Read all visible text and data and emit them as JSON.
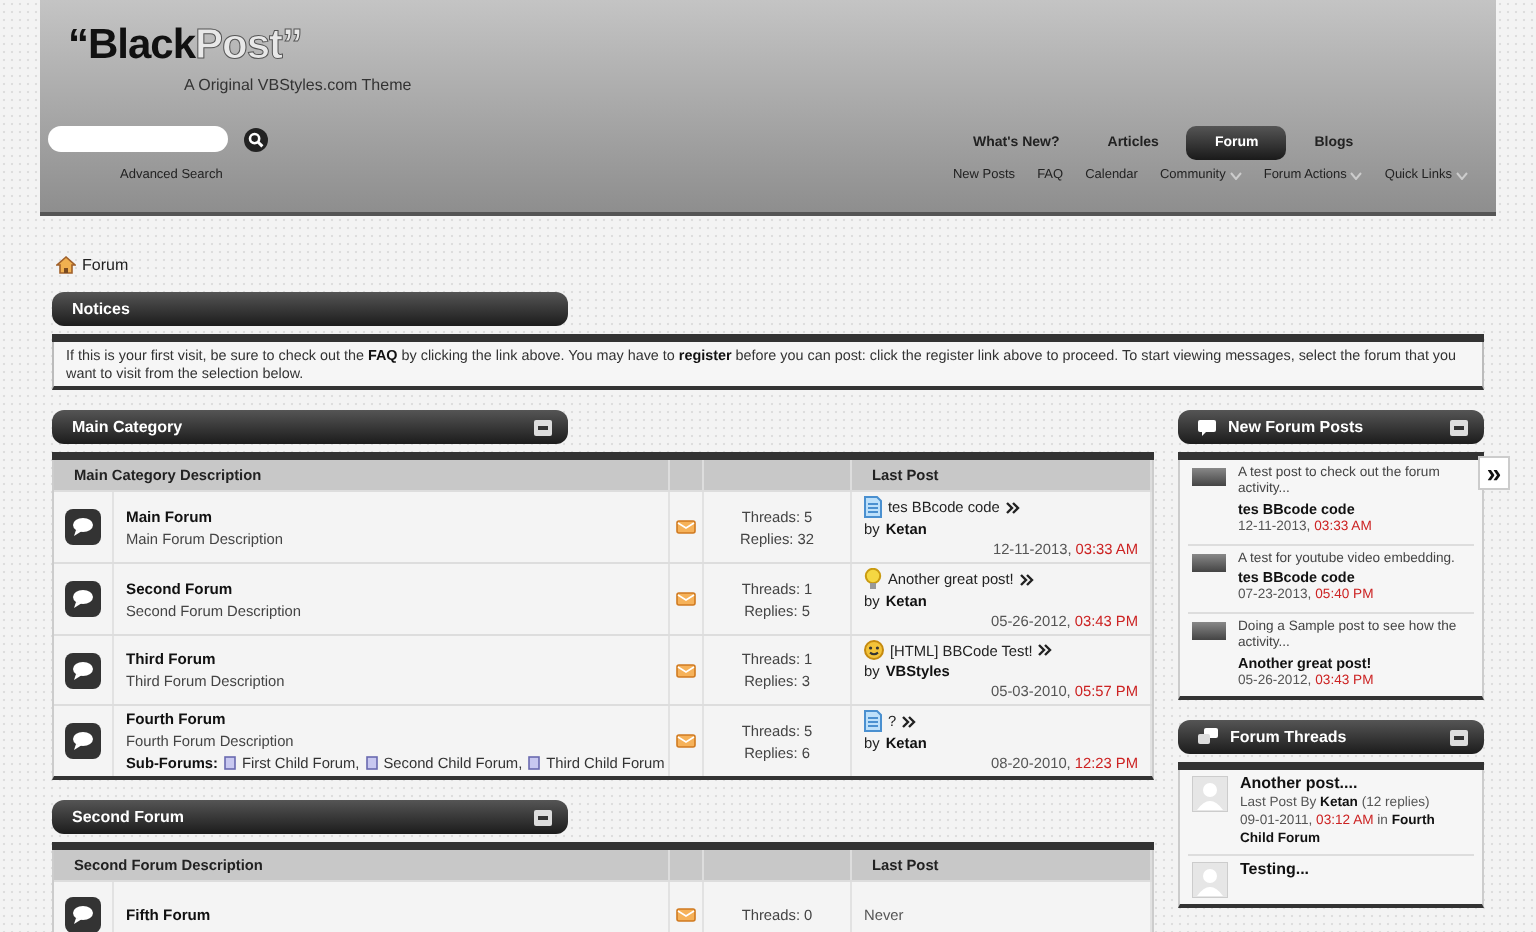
{
  "header": {
    "logo": {
      "part_1": "“Black",
      "part_2": "Post”"
    },
    "tagline": "A Original VBStyles.com Theme",
    "advanced_search": "Advanced Search",
    "tabs": [
      {
        "label": "What's New?",
        "selected": false
      },
      {
        "label": "Articles",
        "selected": false
      },
      {
        "label": "Forum",
        "selected": true
      },
      {
        "label": "Blogs",
        "selected": false
      }
    ],
    "subnav": [
      {
        "label": "New Posts",
        "dropdown": false
      },
      {
        "label": "FAQ",
        "dropdown": false
      },
      {
        "label": "Calendar",
        "dropdown": false
      },
      {
        "label": "Community",
        "dropdown": true
      },
      {
        "label": "Forum Actions",
        "dropdown": true
      },
      {
        "label": "Quick Links",
        "dropdown": true
      }
    ]
  },
  "breadcrumb": "Forum",
  "notices": {
    "title": "Notices",
    "text": "If this is your first visit, be sure to check out the **FAQ** by clicking the link above. You may have to **register** before you can post: click the register link above to proceed. To start viewing messages, select the forum that you want to visit from the selection below."
  },
  "categories": [
    {
      "title": "Main Category",
      "columns": [
        "Main Category Description",
        "Last Post"
      ],
      "forums": [
        {
          "name": "Main Forum",
          "description": "Main Forum Description",
          "threads": "Threads: 5",
          "replies": "Replies: 32",
          "last_post": {
            "kind": "document",
            "title": "tes BBcode code",
            "by": "by",
            "author": "Ketan",
            "date": "12-11-2013,",
            "time": "03:33 AM"
          }
        },
        {
          "name": "Second Forum",
          "description": "Second Forum Description",
          "threads": "Threads: 1",
          "replies": "Replies: 5",
          "last_post": {
            "kind": "lightbulb",
            "title": "Another great post!",
            "by": "by",
            "author": "Ketan",
            "date": "05-26-2012,",
            "time": "03:43 PM"
          }
        },
        {
          "name": "Third Forum",
          "description": "Third Forum Description",
          "threads": "Threads: 1",
          "replies": "Replies: 3",
          "last_post": {
            "kind": "smiley",
            "title": "[HTML] BBCode Test!",
            "by": "by",
            "author": "VBStyles",
            "date": "05-03-2010,",
            "time": "05:57 PM"
          }
        },
        {
          "name": "Fourth Forum",
          "description": "Fourth Forum Description",
          "sub_forums_label": "Sub-Forums:",
          "sub_forums": [
            "First Child Forum,",
            "Second Child Forum,",
            "Third Child Forum"
          ],
          "threads": "Threads: 5",
          "replies": "Replies: 6",
          "last_post": {
            "kind": "document",
            "title": "?",
            "by": "by",
            "author": "Ketan",
            "date": "08-20-2010,",
            "time": "12:23 PM"
          }
        }
      ]
    },
    {
      "title": "Second Forum",
      "columns": [
        "Second Forum Description",
        "Last Post"
      ],
      "forums": [
        {
          "name": "Fifth Forum",
          "threads": "Threads: 0",
          "last_post": {
            "kind": "never",
            "text": "Never"
          }
        }
      ]
    }
  ],
  "sidebar": [
    {
      "kind": "posts",
      "title": "New Forum Posts",
      "items": [
        {
          "excerpt": "A test post to check out the forum activity...",
          "title": "tes BBcode code",
          "date": "12-11-2013,",
          "time": "03:33 AM"
        },
        {
          "excerpt": "A test for youtube video embedding.",
          "title": "tes BBcode code",
          "date": "07-23-2013,",
          "time": "05:40 PM"
        },
        {
          "excerpt": "Doing a Sample post to see how the activity...",
          "title": "Another great post!",
          "date": "05-26-2012,",
          "time": "03:43 PM"
        }
      ]
    },
    {
      "kind": "threads",
      "title": "Forum Threads",
      "items": [
        {
          "title": "Another post....",
          "meta": "Last Post By **Ketan** (12 replies)",
          "date": "09-01-2011,",
          "time": "03:12 AM",
          "location": "in **Fourth Child Forum**"
        },
        {
          "title": "Testing..."
        }
      ]
    }
  ],
  "expand_button": "»"
}
